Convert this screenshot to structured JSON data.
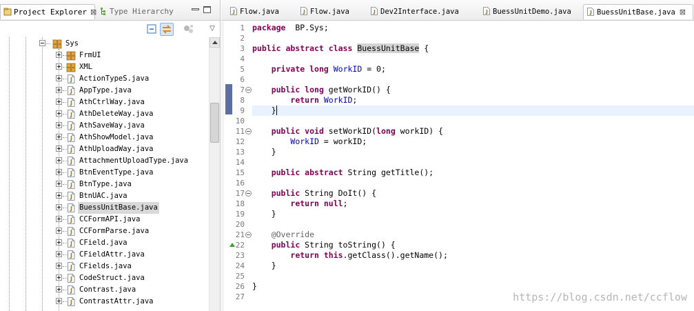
{
  "left_panel": {
    "tabs": [
      {
        "label": "Project Explorer",
        "close": "⊠"
      },
      {
        "label": "Type Hierarchy"
      }
    ],
    "toolbar": {
      "view_menu": "▽"
    }
  },
  "tree": [
    {
      "label": "Sys",
      "type": "package",
      "expander": "minus",
      "level": 0
    },
    {
      "label": "FrmUI",
      "type": "package",
      "expander": "plus",
      "level": 1
    },
    {
      "label": "XML",
      "type": "package",
      "expander": "plus",
      "level": 1
    },
    {
      "label": "ActionTypeS.java",
      "type": "java",
      "expander": "plus",
      "level": 1
    },
    {
      "label": "AppType.java",
      "type": "java",
      "expander": "plus",
      "level": 1
    },
    {
      "label": "AthCtrlWay.java",
      "type": "java",
      "expander": "plus",
      "level": 1
    },
    {
      "label": "AthDeleteWay.java",
      "type": "java",
      "expander": "plus",
      "level": 1
    },
    {
      "label": "AthSaveWay.java",
      "type": "java",
      "expander": "plus",
      "level": 1
    },
    {
      "label": "AthShowModel.java",
      "type": "java",
      "expander": "plus",
      "level": 1
    },
    {
      "label": "AthUploadWay.java",
      "type": "java",
      "expander": "plus",
      "level": 1
    },
    {
      "label": "AttachmentUploadType.java",
      "type": "java",
      "expander": "plus",
      "level": 1
    },
    {
      "label": "BtnEventType.java",
      "type": "java",
      "expander": "plus",
      "level": 1
    },
    {
      "label": "BtnType.java",
      "type": "java",
      "expander": "plus",
      "level": 1
    },
    {
      "label": "BtnUAC.java",
      "type": "java",
      "expander": "plus",
      "level": 1
    },
    {
      "label": "BuessUnitBase.java",
      "type": "java",
      "expander": "plus",
      "level": 1,
      "selected": true
    },
    {
      "label": "CCFormAPI.java",
      "type": "java",
      "expander": "plus",
      "level": 1
    },
    {
      "label": "CCFormParse.java",
      "type": "java",
      "expander": "plus",
      "level": 1
    },
    {
      "label": "CField.java",
      "type": "java",
      "expander": "plus",
      "level": 1
    },
    {
      "label": "CFieldAttr.java",
      "type": "java",
      "expander": "plus",
      "level": 1
    },
    {
      "label": "CFields.java",
      "type": "java",
      "expander": "plus",
      "level": 1
    },
    {
      "label": "CodeStruct.java",
      "type": "java",
      "expander": "plus",
      "level": 1
    },
    {
      "label": "Contrast.java",
      "type": "java",
      "expander": "plus",
      "level": 1
    },
    {
      "label": "ContrastAttr.java",
      "type": "java",
      "expander": "plus",
      "level": 1
    }
  ],
  "editor": {
    "tabs": [
      {
        "label": "Flow.java",
        "active": false
      },
      {
        "label": "Flow.java",
        "active": false
      },
      {
        "label": "Dev2Interface.java",
        "active": false
      },
      {
        "label": "BuessUnitDemo.java",
        "active": false
      },
      {
        "label": "BuessUnitBase.java",
        "active": true,
        "close": "⊠"
      }
    ],
    "current_line": 9,
    "lines": [
      {
        "n": "1",
        "tokens": [
          [
            "kw",
            "package"
          ],
          [
            "",
            "  BP.Sys;"
          ]
        ]
      },
      {
        "n": "2",
        "tokens": []
      },
      {
        "n": "3",
        "tokens": [
          [
            "kw",
            "public abstract class"
          ],
          [
            "",
            " "
          ],
          [
            "hl",
            "BuessUnitBase"
          ],
          [
            "",
            " {"
          ]
        ]
      },
      {
        "n": "4",
        "tokens": []
      },
      {
        "n": "5",
        "tokens": [
          [
            "",
            "    "
          ],
          [
            "kw",
            "private long"
          ],
          [
            "",
            " "
          ],
          [
            "fld",
            "WorkID"
          ],
          [
            "",
            " = 0;"
          ]
        ]
      },
      {
        "n": "6",
        "tokens": []
      },
      {
        "n": "7",
        "fold": true,
        "tokens": [
          [
            "",
            "    "
          ],
          [
            "kw",
            "public long"
          ],
          [
            "",
            " getWorkID() {"
          ]
        ]
      },
      {
        "n": "8",
        "tokens": [
          [
            "",
            "        "
          ],
          [
            "kw",
            "return"
          ],
          [
            "",
            " "
          ],
          [
            "fld",
            "WorkID"
          ],
          [
            "",
            ";"
          ]
        ]
      },
      {
        "n": "9",
        "tokens": [
          [
            "",
            "    }"
          ],
          [
            "caret",
            ""
          ]
        ]
      },
      {
        "n": "10",
        "tokens": []
      },
      {
        "n": "11",
        "fold": true,
        "tokens": [
          [
            "",
            "    "
          ],
          [
            "kw",
            "public void"
          ],
          [
            "",
            " setWorkID("
          ],
          [
            "kw",
            "long"
          ],
          [
            "",
            " workID) {"
          ]
        ]
      },
      {
        "n": "12",
        "tokens": [
          [
            "",
            "        "
          ],
          [
            "fld",
            "WorkID"
          ],
          [
            "",
            " = workID;"
          ]
        ]
      },
      {
        "n": "13",
        "tokens": [
          [
            "",
            "    }"
          ]
        ]
      },
      {
        "n": "14",
        "tokens": []
      },
      {
        "n": "15",
        "tokens": [
          [
            "",
            "    "
          ],
          [
            "kw",
            "public abstract"
          ],
          [
            "",
            " String getTitle();"
          ]
        ]
      },
      {
        "n": "16",
        "tokens": []
      },
      {
        "n": "17",
        "fold": true,
        "tokens": [
          [
            "",
            "    "
          ],
          [
            "kw",
            "public"
          ],
          [
            "",
            " String DoIt() {"
          ]
        ]
      },
      {
        "n": "18",
        "tokens": [
          [
            "",
            "        "
          ],
          [
            "kw",
            "return null"
          ],
          [
            "",
            ";"
          ]
        ]
      },
      {
        "n": "19",
        "tokens": [
          [
            "",
            "    }"
          ]
        ]
      },
      {
        "n": "20",
        "tokens": []
      },
      {
        "n": "21",
        "fold": true,
        "tokens": [
          [
            "",
            "    "
          ],
          [
            "ann",
            "@Override"
          ]
        ]
      },
      {
        "n": "22",
        "override": true,
        "tokens": [
          [
            "",
            "    "
          ],
          [
            "kw",
            "public"
          ],
          [
            "",
            " String toString() {"
          ]
        ]
      },
      {
        "n": "23",
        "tokens": [
          [
            "",
            "        "
          ],
          [
            "kw",
            "return this"
          ],
          [
            "",
            ".getClass().getName();"
          ]
        ]
      },
      {
        "n": "24",
        "tokens": [
          [
            "",
            "    }"
          ]
        ]
      },
      {
        "n": "25",
        "tokens": []
      },
      {
        "n": "26",
        "tokens": [
          [
            "",
            "}"
          ]
        ]
      },
      {
        "n": "27",
        "tokens": []
      }
    ]
  },
  "watermark": "https://blog.csdn.net/ccflow",
  "colors": {
    "keyword": "#7f0055",
    "field": "#0000c0",
    "annotation": "#646464",
    "current_line": "#e8f2fe"
  }
}
